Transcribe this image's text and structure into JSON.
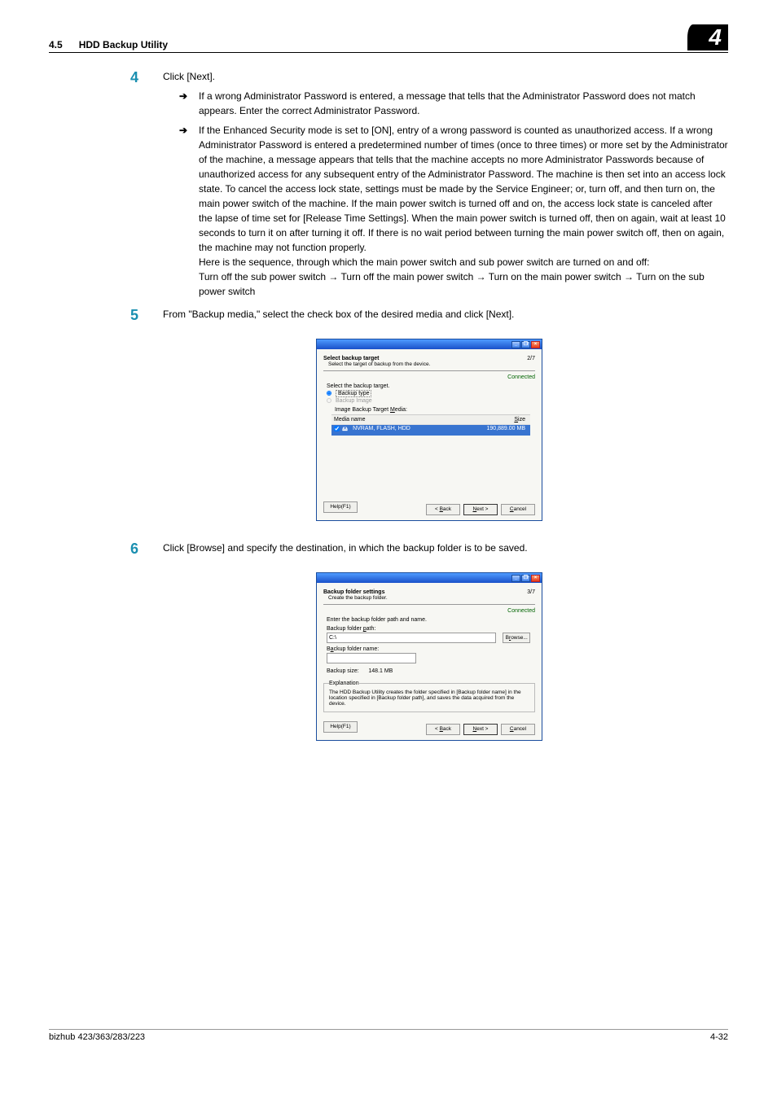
{
  "header": {
    "section_num": "4.5",
    "section_title": "HDD Backup Utility",
    "chapter_num": "4"
  },
  "steps": {
    "s4": {
      "num": "4",
      "main": "Click [Next].",
      "sub1": "If a wrong Administrator Password is entered, a message that tells that the Administrator Password does not match appears. Enter the correct Administrator Password.",
      "sub2": "If the Enhanced Security mode is set to [ON], entry of a wrong password is counted as unauthorized access. If a wrong Administrator Password is entered a predetermined number of times (once to three times) or more set by the Administrator of the machine, a message appears that tells that the machine accepts no more Administrator Passwords because of unauthorized access for any subsequent entry of the Administrator Password. The machine is then set into an access lock state. To cancel the access lock state, settings must be made by the Service Engineer; or, turn off, and then turn on, the main power switch of the machine. If the main power switch is turned off and on, the access lock state is canceled after the lapse of time set for [Release Time Settings]. When the main power switch is turned off, then on again, wait at least 10 seconds to turn it on after turning it off. If there is no wait period between turning the main power switch off, then on again, the machine may not function properly.",
      "sub2b": "Here is the sequence, through which the main power switch and sub power switch are turned on and off:",
      "sub2c": "Turn off the sub power switch → Turn off the main power switch → Turn on the main power switch → Turn on the sub power switch"
    },
    "s5": {
      "num": "5",
      "main": "From \"Backup media,\" select the check box of the desired media and click [Next]."
    },
    "s6": {
      "num": "6",
      "main": "Click [Browse] and specify the destination, in which the backup folder is to be saved."
    }
  },
  "dialog1": {
    "title": "Select backup target",
    "subtitle": "Select the target of backup from the device.",
    "page": "2/7",
    "connected": "Connected",
    "label_select": "Select the backup target.",
    "opt_type": "Backup type",
    "opt_image": "Backup Image",
    "media_label": "Image Backup Target Media:",
    "col_name": "Media name",
    "col_size": "Size",
    "row_name": "NVRAM, FLASH, HDD",
    "row_size": "190,889.00 MB",
    "btn_help": "Help(F1)",
    "btn_back": "< Back",
    "btn_next": "Next >",
    "btn_cancel": "Cancel"
  },
  "dialog2": {
    "title": "Backup folder settings",
    "subtitle": "Create the backup folder.",
    "page": "3/7",
    "connected": "Connected",
    "label_enter": "Enter the backup folder path and name.",
    "label_path": "Backup folder path:",
    "path_value": "C:\\",
    "btn_browse": "Browse...",
    "label_name": "Backup folder name:",
    "label_size": "Backup size:",
    "size_value": "148.1 MB",
    "legend": "Explanation",
    "explain": "The HDD Backup Utility creates the folder specified in [Backup folder name] in the location specified in [Backup folder path], and saves the data acquired from the device.",
    "btn_help": "Help(F1)",
    "btn_back": "< Back",
    "btn_next": "Next >",
    "btn_cancel": "Cancel"
  },
  "footer": {
    "left": "bizhub 423/363/283/223",
    "right": "4-32"
  }
}
